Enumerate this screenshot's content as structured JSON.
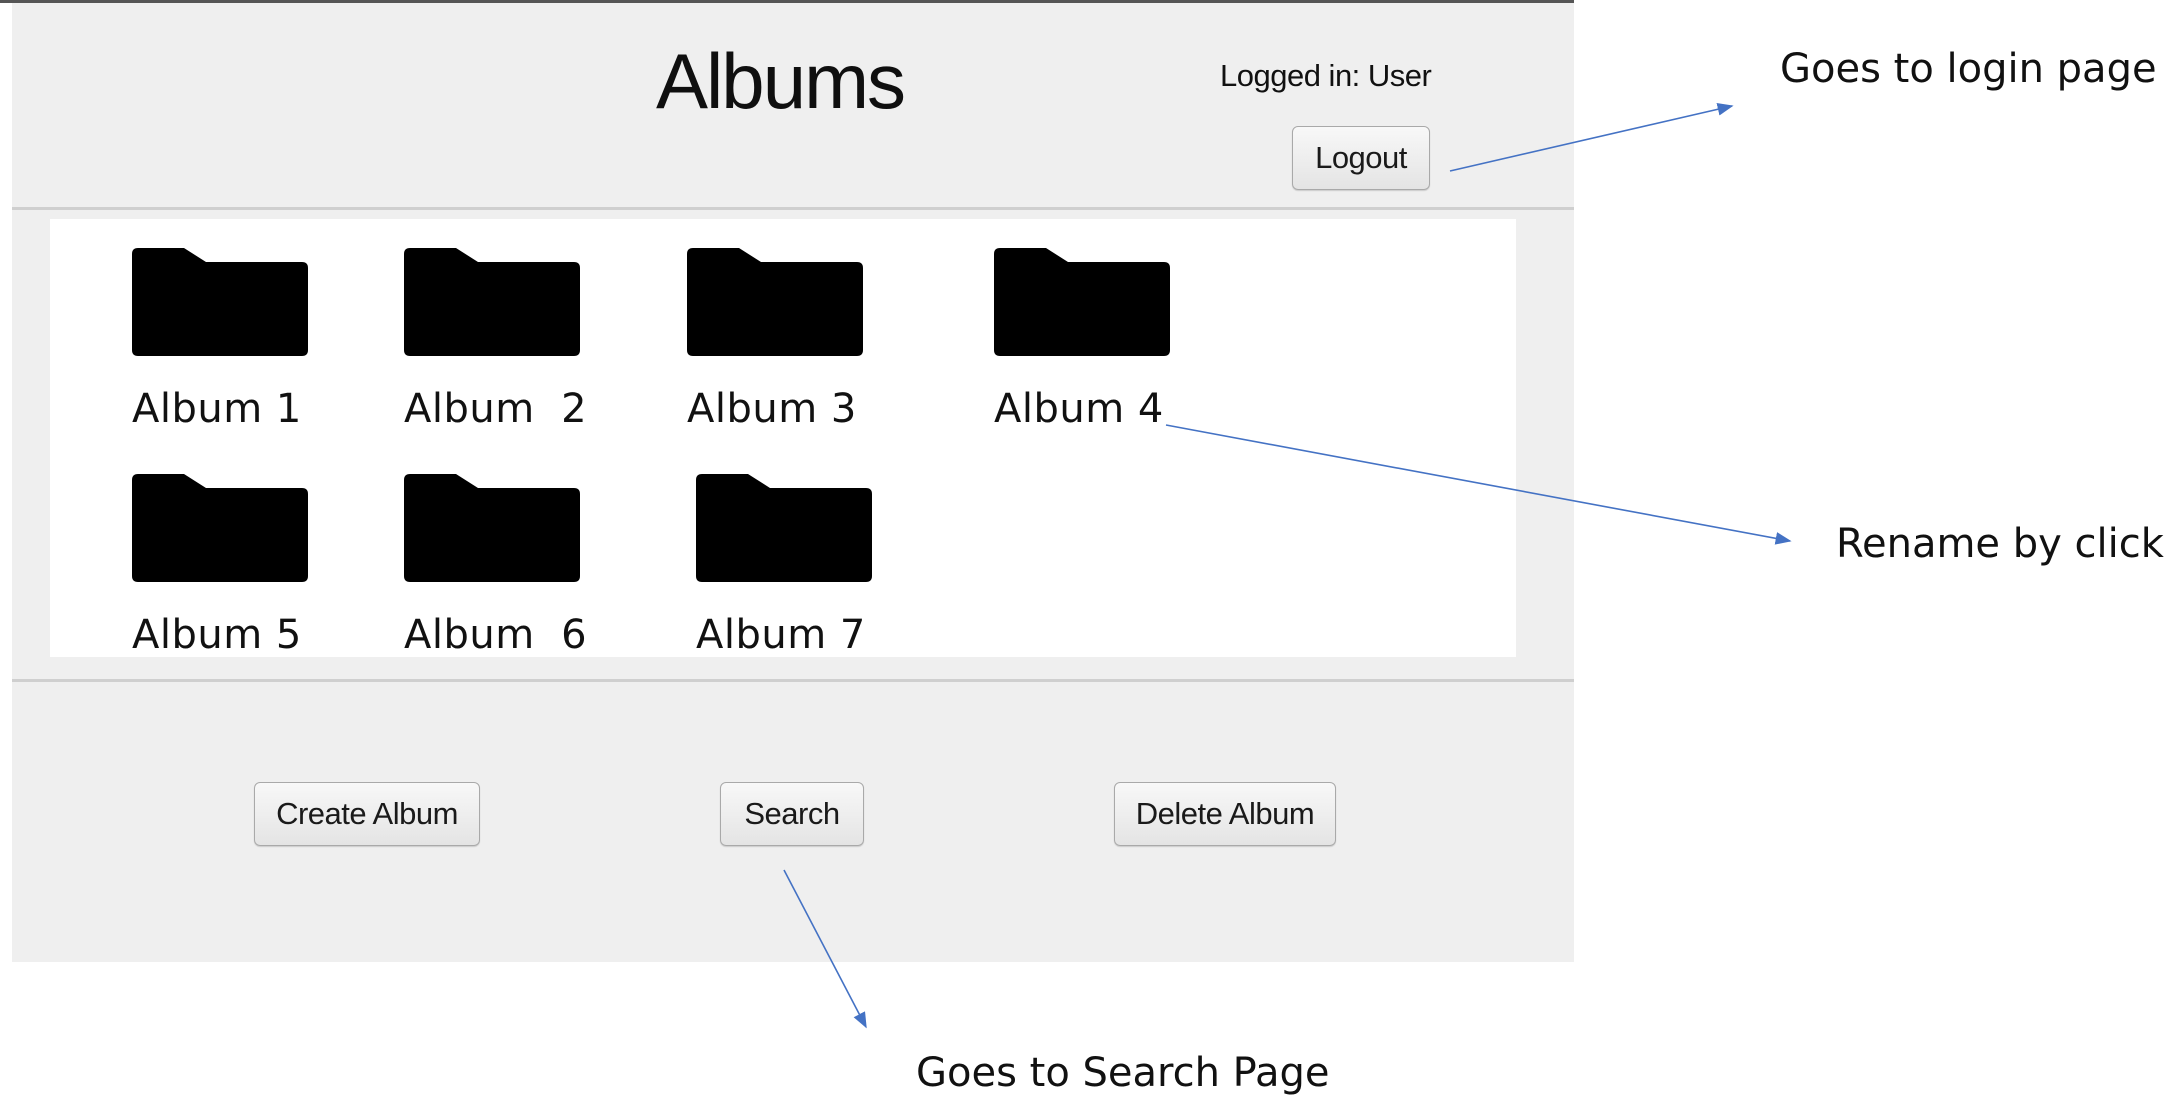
{
  "header": {
    "title": "Albums",
    "logged_in_text": "Logged in: User",
    "logout_label": "Logout"
  },
  "albums": [
    {
      "label": "Album 1",
      "icon": "folder-icon"
    },
    {
      "label": "Album  2",
      "icon": "folder-icon"
    },
    {
      "label": "Album 3",
      "icon": "folder-icon"
    },
    {
      "label": "Album 4",
      "icon": "folder-icon"
    },
    {
      "label": "Album 5",
      "icon": "folder-icon"
    },
    {
      "label": "Album  6",
      "icon": "folder-icon"
    },
    {
      "label": "Album 7",
      "icon": "folder-icon"
    }
  ],
  "footer": {
    "create_label": "Create Album",
    "search_label": "Search",
    "delete_label": "Delete Album"
  },
  "annotations": {
    "logout": "Goes to login page",
    "rename": "Rename by click",
    "search": "Goes to Search Page"
  },
  "colors": {
    "window_bg": "#efefef",
    "panel_bg": "#ffffff",
    "arrow": "#4472c4"
  }
}
